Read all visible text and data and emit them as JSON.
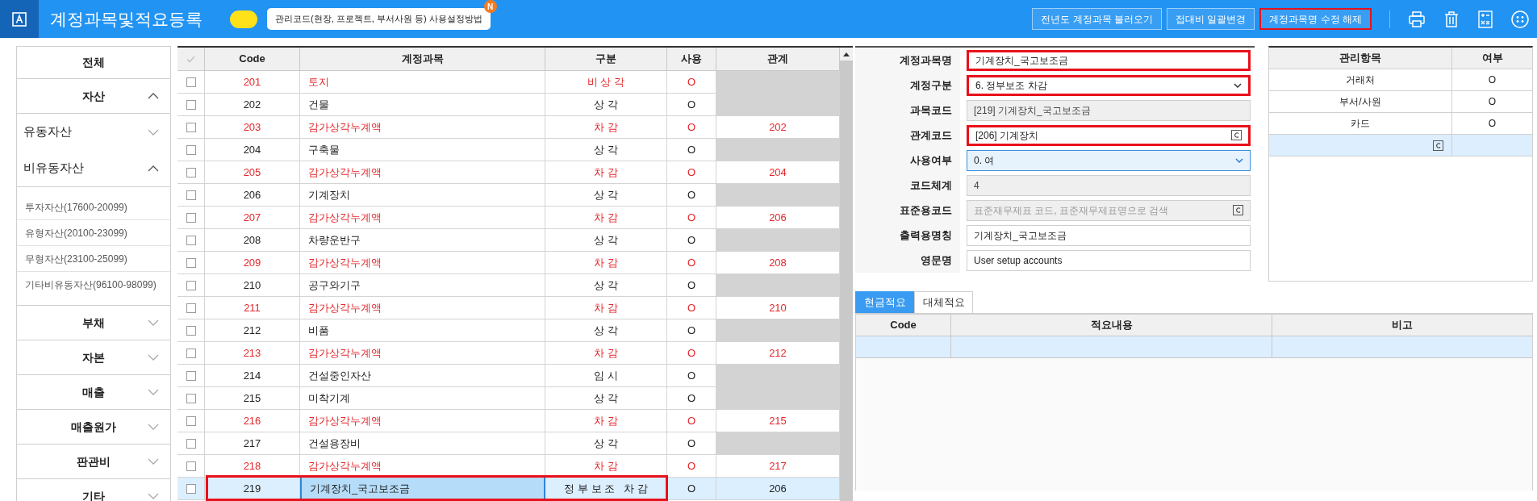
{
  "header": {
    "title": "계정과목및적요등록",
    "toggle": {
      "on": true
    },
    "tooltip": {
      "text": "관리코드(현장, 프로젝트, 부서사원 등) 사용설정방법",
      "badge": "N"
    },
    "buttons": [
      {
        "label": "전년도 계정과목 불러오기",
        "highlighted": false
      },
      {
        "label": "접대비 일괄변경",
        "highlighted": false
      },
      {
        "label": "계정과목명 수정 해제",
        "highlighted": true
      }
    ]
  },
  "sidebar": {
    "items": [
      {
        "kind": "all",
        "label": "전체"
      },
      {
        "kind": "group",
        "label": "자산",
        "expanded": true,
        "children": [
          {
            "kind": "subgroup",
            "label": "유동자산",
            "expanded": false
          },
          {
            "kind": "subgroup",
            "label": "비유동자산",
            "expanded": true,
            "children": [
              {
                "kind": "leaf",
                "label": "투자자산(17600-20099)"
              },
              {
                "kind": "leaf",
                "label": "유형자산(20100-23099)"
              },
              {
                "kind": "leaf",
                "label": "무형자산(23100-25099)"
              },
              {
                "kind": "leaf",
                "label": "기타비유동자산(96100-98099)"
              }
            ]
          }
        ]
      },
      {
        "kind": "group",
        "label": "부채",
        "expanded": false
      },
      {
        "kind": "group",
        "label": "자본",
        "expanded": false
      },
      {
        "kind": "group",
        "label": "매출",
        "expanded": false
      },
      {
        "kind": "group",
        "label": "매출원가",
        "expanded": false
      },
      {
        "kind": "group",
        "label": "판관비",
        "expanded": false
      },
      {
        "kind": "group",
        "label": "기타",
        "expanded": false
      }
    ]
  },
  "table": {
    "columns": [
      "Code",
      "계정과목",
      "구분",
      "사용",
      "관계"
    ],
    "rows": [
      {
        "kind": "contra",
        "checked": false,
        "selected": false,
        "highlighted": false,
        "code": "201",
        "name": "토지",
        "type": "비 상 각",
        "use": "O"
      },
      {
        "kind": "normal",
        "checked": false,
        "selected": false,
        "highlighted": false,
        "code": "202",
        "name": "건물",
        "type": "상 각",
        "use": "O"
      },
      {
        "kind": "contra",
        "checked": false,
        "selected": false,
        "highlighted": false,
        "code": "203",
        "name": "감가상각누계액",
        "type": "차 감",
        "use": "O",
        "relation": "202"
      },
      {
        "kind": "normal",
        "checked": false,
        "selected": false,
        "highlighted": false,
        "code": "204",
        "name": "구축물",
        "type": "상 각",
        "use": "O"
      },
      {
        "kind": "contra",
        "checked": false,
        "selected": false,
        "highlighted": false,
        "code": "205",
        "name": "감가상각누계액",
        "type": "차 감",
        "use": "O",
        "relation": "204"
      },
      {
        "kind": "normal",
        "checked": false,
        "selected": false,
        "highlighted": false,
        "code": "206",
        "name": "기계장치",
        "type": "상 각",
        "use": "O"
      },
      {
        "kind": "contra",
        "checked": false,
        "selected": false,
        "highlighted": false,
        "code": "207",
        "name": "감가상각누계액",
        "type": "차 감",
        "use": "O",
        "relation": "206"
      },
      {
        "kind": "normal",
        "checked": false,
        "selected": false,
        "highlighted": false,
        "code": "208",
        "name": "차량운반구",
        "type": "상 각",
        "use": "O"
      },
      {
        "kind": "contra",
        "checked": false,
        "selected": false,
        "highlighted": false,
        "code": "209",
        "name": "감가상각누계액",
        "type": "차 감",
        "use": "O",
        "relation": "208"
      },
      {
        "kind": "normal",
        "checked": false,
        "selected": false,
        "highlighted": false,
        "code": "210",
        "name": "공구와기구",
        "type": "상 각",
        "use": "O"
      },
      {
        "kind": "contra",
        "checked": false,
        "selected": false,
        "highlighted": false,
        "code": "211",
        "name": "감가상각누계액",
        "type": "차 감",
        "use": "O",
        "relation": "210"
      },
      {
        "kind": "normal",
        "checked": false,
        "selected": false,
        "highlighted": false,
        "code": "212",
        "name": "비품",
        "type": "상 각",
        "use": "O"
      },
      {
        "kind": "contra",
        "checked": false,
        "selected": false,
        "highlighted": false,
        "code": "213",
        "name": "감가상각누계액",
        "type": "차 감",
        "use": "O",
        "relation": "212"
      },
      {
        "kind": "normal",
        "checked": false,
        "selected": false,
        "highlighted": false,
        "code": "214",
        "name": "건설중인자산",
        "type": "임 시",
        "use": "O"
      },
      {
        "kind": "normal",
        "checked": false,
        "selected": false,
        "highlighted": false,
        "code": "215",
        "name": "미착기계",
        "type": "상 각",
        "use": "O"
      },
      {
        "kind": "contra",
        "checked": false,
        "selected": false,
        "highlighted": false,
        "code": "216",
        "name": "감가상각누계액",
        "type": "차 감",
        "use": "O",
        "relation": "215"
      },
      {
        "kind": "normal",
        "checked": false,
        "selected": false,
        "highlighted": false,
        "code": "217",
        "name": "건설용장비",
        "type": "상 각",
        "use": "O"
      },
      {
        "kind": "contra",
        "checked": false,
        "selected": false,
        "highlighted": false,
        "code": "218",
        "name": "감가상각누계액",
        "type": "차 감",
        "use": "O",
        "relation": "217"
      },
      {
        "kind": "normal",
        "checked": false,
        "selected": true,
        "highlighted": true,
        "code": "219",
        "name": "기계장치_국고보조금",
        "type": "정 부 보 조   차 감",
        "use": "O",
        "relation": "206"
      }
    ]
  },
  "form": {
    "fields": [
      {
        "kind": "text",
        "label": "계정과목명",
        "value": "기계장치_국고보조금",
        "highlighted": true,
        "focused": false
      },
      {
        "kind": "select",
        "label": "계정구분",
        "value": "6. 정부보조 차감",
        "highlighted": true,
        "focused": false
      },
      {
        "kind": "readonly",
        "label": "과목코드",
        "value": "[219] 기계장치_국고보조금",
        "highlighted": false,
        "focused": false
      },
      {
        "kind": "lookup",
        "label": "관계코드",
        "value": "[206] 기계장치",
        "highlighted": true,
        "focused": false
      },
      {
        "kind": "select",
        "label": "사용여부",
        "value": "0. 여",
        "highlighted": false,
        "focused": true
      },
      {
        "kind": "readonly",
        "label": "코드체계",
        "value": "4",
        "highlighted": false,
        "focused": false
      },
      {
        "kind": "lookup_disabled",
        "label": "표준용코드",
        "placeholder": "표준재무제표 코드, 표준재무제표명으로 검색",
        "highlighted": false,
        "focused": false
      },
      {
        "kind": "text",
        "label": "출력용명칭",
        "value": "기계장치_국고보조금",
        "highlighted": false,
        "focused": false
      },
      {
        "kind": "text",
        "label": "영문명",
        "value": "User setup accounts",
        "highlighted": false,
        "focused": false
      }
    ]
  },
  "management": {
    "columns": [
      "관리항목",
      "여부"
    ],
    "rows": [
      {
        "item": "거래처",
        "flag": "O"
      },
      {
        "item": "부서/사원",
        "flag": "O"
      },
      {
        "item": "카드",
        "flag": "O"
      }
    ]
  },
  "summary": {
    "tabs": [
      {
        "label": "현금적요",
        "selected": true
      },
      {
        "label": "대체적요",
        "selected": false
      }
    ],
    "columns": [
      "Code",
      "적요내용",
      "비고"
    ]
  }
}
